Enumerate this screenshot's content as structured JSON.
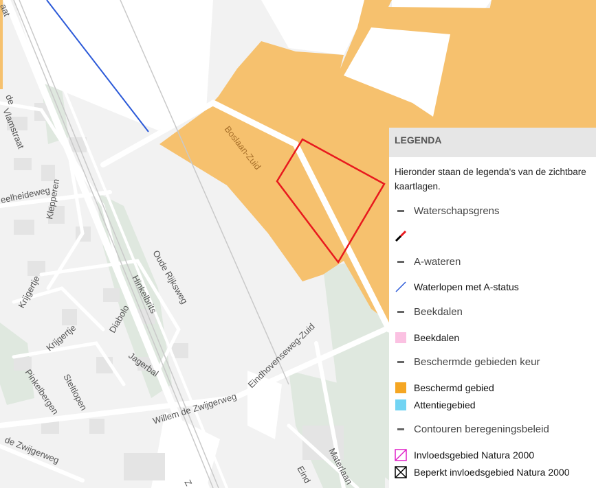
{
  "map": {
    "colors": {
      "background": "#f2f2f2",
      "protected_area": "#f6c16e",
      "green": "#dfe8df",
      "road": "#ffffff",
      "waterway_blue": "#2b59d8",
      "parcel_outline": "#e8191e"
    },
    "street_labels": {
      "vlamstraat": "Vlamstraat",
      "de_vlam": "de",
      "eelheideweg": "eelheideweg",
      "klepperen": "Klepperen",
      "oude_rijksweg": "Oude Rijksweg",
      "krijgertje_1": "Krijgertje",
      "krijgertje_2": "Krijgertje",
      "hinkelbrits": "Hinkelbrits",
      "diabolo": "Diabolo",
      "jagerbal": "Jagerbal",
      "pinkelbergen": "Pinkelbergen",
      "steltlopen": "Steltlopen",
      "willem_de_zwijgerweg": "Willem de Zwijgerweg",
      "de_zwijgerweg": "de Zwijgerweg",
      "eindhovenseweg_zuid": "Eindhovenseweg-Zuid",
      "boslaan_zuid": "Boslaan-Zuid",
      "materlaan": "Materlaan",
      "eind": "Eind",
      "aat": "aat",
      "z": "Z"
    }
  },
  "legend": {
    "title": "LEGENDA",
    "intro": "Hieronder staan de legenda's van de zichtbare kaartlagen.",
    "rows": [
      {
        "type": "group",
        "label": "Waterschapsgrens",
        "symbol": "dash"
      },
      {
        "type": "item",
        "label": "",
        "symbol": "red-black-line",
        "color": "#e8191e"
      },
      {
        "type": "group",
        "label": "A-wateren",
        "symbol": "dash"
      },
      {
        "type": "item",
        "label": "Waterlopen met A-status",
        "symbol": "blue-line",
        "color": "#2b59d8"
      },
      {
        "type": "group",
        "label": "Beekdalen",
        "symbol": "dash"
      },
      {
        "type": "item",
        "label": "Beekdalen",
        "symbol": "fill",
        "color": "#fbc1e2"
      },
      {
        "type": "group",
        "label": "Beschermde gebieden keur",
        "symbol": "dash"
      },
      {
        "type": "item",
        "label": "Beschermd gebied",
        "symbol": "fill",
        "color": "#f5a623"
      },
      {
        "type": "item",
        "label": "Attentiegebied",
        "symbol": "fill",
        "color": "#72d4f3"
      },
      {
        "type": "group",
        "label": "Contouren beregeningsbeleid",
        "symbol": "dash"
      },
      {
        "type": "item",
        "label": "Invloedsgebied Natura 2000",
        "symbol": "hatch-magenta",
        "color": "#e020c8"
      },
      {
        "type": "item",
        "label": "Beperkt invloedsgebied Natura 2000",
        "symbol": "cross-black",
        "color": "#000000"
      }
    ]
  }
}
